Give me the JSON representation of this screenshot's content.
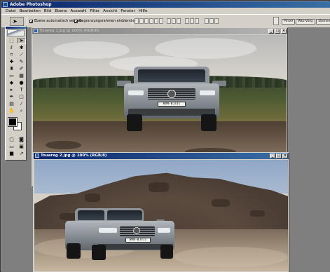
{
  "app": {
    "title": "Adobe Photoshop"
  },
  "menubar": {
    "items": [
      "Datei",
      "Bearbeiten",
      "Bild",
      "Ebene",
      "Auswahl",
      "Filter",
      "Ansicht",
      "Fenster",
      "Hilfe"
    ]
  },
  "options_bar": {
    "auto_select_label": "Ebene automatisch wählen",
    "auto_select_checked": true,
    "bounding_box_label": "Begrenzungsrahmen einblenden",
    "bounding_box_checked": true,
    "palette_tabs": [
      "Pinsel",
      "Wkz-Vorg.",
      "Ebenen"
    ]
  },
  "toolbox": {
    "tools": [
      {
        "name": "marquee-tool",
        "glyph": "⬚"
      },
      {
        "name": "move-tool",
        "glyph": "➤",
        "active": true
      },
      {
        "name": "lasso-tool",
        "glyph": "ℓ"
      },
      {
        "name": "magic-wand-tool",
        "glyph": "✱"
      },
      {
        "name": "crop-tool",
        "glyph": "⌗"
      },
      {
        "name": "slice-tool",
        "glyph": "⟋"
      },
      {
        "name": "healing-brush-tool",
        "glyph": "✚"
      },
      {
        "name": "brush-tool",
        "glyph": "✎"
      },
      {
        "name": "clone-stamp-tool",
        "glyph": "♜"
      },
      {
        "name": "history-brush-tool",
        "glyph": "✐"
      },
      {
        "name": "eraser-tool",
        "glyph": "▭"
      },
      {
        "name": "gradient-tool",
        "glyph": "▦"
      },
      {
        "name": "blur-tool",
        "glyph": "◆"
      },
      {
        "name": "dodge-tool",
        "glyph": "●"
      },
      {
        "name": "path-selection-tool",
        "glyph": "▸"
      },
      {
        "name": "type-tool",
        "glyph": "T"
      },
      {
        "name": "pen-tool",
        "glyph": "✒"
      },
      {
        "name": "shape-tool",
        "glyph": "▢"
      },
      {
        "name": "notes-tool",
        "glyph": "▤"
      },
      {
        "name": "eyedropper-tool",
        "glyph": "⁄"
      },
      {
        "name": "hand-tool",
        "glyph": "✋"
      },
      {
        "name": "zoom-tool",
        "glyph": "⌕"
      }
    ],
    "foreground_color": "#000000",
    "background_color": "#ffffff",
    "mode_buttons": [
      {
        "name": "standard-mode-icon",
        "glyph": "▢"
      },
      {
        "name": "quick-mask-icon",
        "glyph": "◙"
      },
      {
        "name": "screen-mode-standard-icon",
        "glyph": "▭"
      },
      {
        "name": "screen-mode-full-menu-icon",
        "glyph": "▣"
      },
      {
        "name": "screen-mode-full-icon",
        "glyph": "■"
      },
      {
        "name": "jump-to-imageready-icon",
        "glyph": "↗"
      }
    ]
  },
  "documents": [
    {
      "title": "Touareg 1.jpg @ 100% (RGB/8)",
      "active": false,
      "plate_text": "WUN-BJ311"
    },
    {
      "title": "Touareg 2.jpg @ 100% (RGB/8)",
      "active": true,
      "plate_text": "WUN-BJ311"
    }
  ],
  "colors": {
    "active_title": "#0a246a",
    "inactive_title": "#808080",
    "chrome": "#d4d0c8",
    "workspace": "#7f7f7f"
  }
}
